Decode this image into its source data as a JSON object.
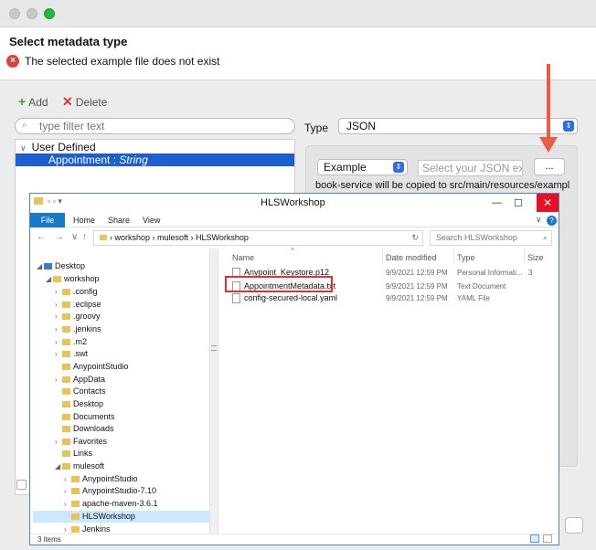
{
  "dialog": {
    "title": "Select metadata type",
    "error_message": "The selected example file does not exist",
    "toolbar": {
      "add_label": "Add",
      "delete_label": "Delete"
    },
    "filter_placeholder": "type filter text",
    "tree": {
      "group_label": "User Defined",
      "selected_item": "Appointment",
      "selected_item_type": "String"
    },
    "type_label": "Type",
    "type_value": "JSON",
    "example_value": "Example",
    "json_placeholder": "Select your JSON ex",
    "browse_label": "...",
    "copy_note": "book-service will be copied to src/main/resources/exampl"
  },
  "explorer": {
    "title": "HLSWorkshop",
    "ribbon_tabs": [
      "File",
      "Home",
      "Share",
      "View"
    ],
    "address": [
      "workshop",
      "mulesoft",
      "HLSWorkshop"
    ],
    "search_placeholder": "Search HLSWorkshop",
    "nav_tree": [
      {
        "label": "Desktop"
      },
      {
        "label": "workshop"
      },
      {
        "label": ".config"
      },
      {
        "label": ".eclipse"
      },
      {
        "label": ".groovy"
      },
      {
        "label": ".jenkins"
      },
      {
        "label": ".m2"
      },
      {
        "label": ".swt"
      },
      {
        "label": "AnypointStudio"
      },
      {
        "label": "AppData"
      },
      {
        "label": "Contacts"
      },
      {
        "label": "Desktop"
      },
      {
        "label": "Documents"
      },
      {
        "label": "Downloads"
      },
      {
        "label": "Favorites"
      },
      {
        "label": "Links"
      },
      {
        "label": "mulesoft"
      },
      {
        "label": "AnypointStudio"
      },
      {
        "label": "AnypointStudio-7.10"
      },
      {
        "label": "apache-maven-3.6.1"
      },
      {
        "label": "HLSWorkshop"
      },
      {
        "label": "Jenkins"
      }
    ],
    "columns": [
      "Name",
      "Date modified",
      "Type",
      "Size"
    ],
    "files": [
      {
        "name": "Anypoint_Keystore.p12",
        "date": "9/9/2021 12:59 PM",
        "type": "Personal Informati...",
        "size": "3"
      },
      {
        "name": "AppointmentMetadata.txt",
        "date": "9/9/2021 12:59 PM",
        "type": "Text Document",
        "size": ""
      },
      {
        "name": "config-secured-local.yaml",
        "date": "9/9/2021 12:59 PM",
        "type": "YAML File",
        "size": ""
      }
    ],
    "status": "3 items"
  },
  "colors": {
    "accent": "#1c5fd0",
    "arrow": "#ec5b45",
    "highlight_box": "#e0322a",
    "win_blue": "#1979ca"
  }
}
